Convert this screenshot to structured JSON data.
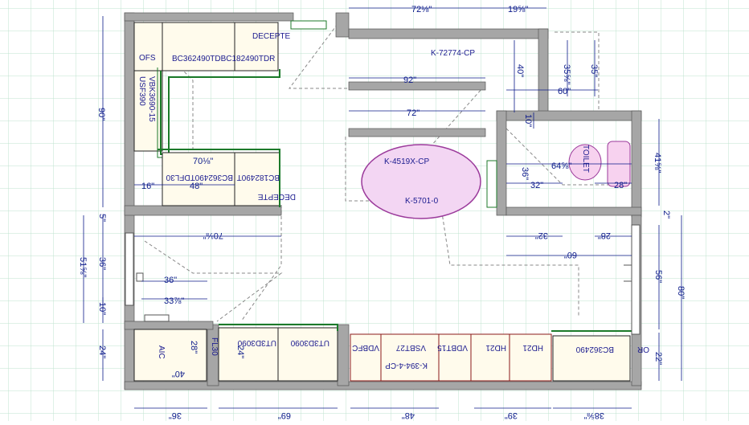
{
  "plan": {
    "colors": {
      "grid": "#bfe3cf",
      "wall": "#a6a6a6",
      "dimension": "#0b1a8a",
      "cabinet_fill": "#fffbec",
      "cabinet_outline": "#1c7a2a",
      "appliance_outline": "#8b1a1a",
      "toilet_fill": "#f7d2ef",
      "island_fill": "#f3d6f3",
      "island_outline": "#9b3a9b",
      "dashed": "#888888"
    },
    "cabinet_labels": {
      "bc362490": "BC362490TDBC182490TDR",
      "decepte_top": "DECEPTE",
      "ofs": "OFS",
      "vbk": "VBK3690-15",
      "usf": "USF390",
      "bc_lower": "BC362490TDFL30",
      "bc18": "BC182490T",
      "decepte_low": "DECEPTE",
      "island_cp": "K-4519X-CP",
      "island_small": "K-5701-0",
      "k72774": "K-72774-CP",
      "toilet": "TOILET",
      "aic": "AIC",
      "fl30": "FL30",
      "ut_a": "UT3D3090",
      "ut_b": "UT3D3090",
      "vdbfc": "VDBFC",
      "vsbt27": "VSBT27",
      "vdbt15": "VDBT15",
      "k394": "K-394-4-CP",
      "hd21a": "HD21",
      "hd21b": "HD21",
      "bc362490_r": "BC362490",
      "or": "OR"
    },
    "dimensions": {
      "top_72": "72⅛\"",
      "top_19": "19⅝\"",
      "left_90": "90\"",
      "d_92": "92\"",
      "d_72": "72\"",
      "d_40": "40\"",
      "d_35a": "35⅝\"",
      "d_35b": "35\"",
      "d_60a": "60\"",
      "d_10": "10\"",
      "d_64": "64⅝\"",
      "d_32a": "32\"",
      "d_28a": "28\"",
      "d_36": "36\"",
      "d_41": "41⅝\"",
      "d_16": "16\"",
      "d_48": "48\"",
      "d_70a": "70⅛\"",
      "d_70b": "70⅛\"",
      "d_32b": "32\"",
      "d_28b": "28\"",
      "d_60b": "60\"",
      "d_51": "51⅝\"",
      "d_36v": "36\"",
      "d_10v": "10\"",
      "d_24": "24\"",
      "d_36h": "36\"",
      "d_33": "33⅞\"",
      "d_56": "56\"",
      "d_80": "80\"",
      "d_22": "22\"",
      "d_28c": "28\"",
      "d_24b": "24\"",
      "d_40b": "40\"",
      "b_36": "36\"",
      "b_69": "69\"",
      "b_48": "48\"",
      "b_39": "39\"",
      "b_38": "38⅝\"",
      "d_5": "5\"",
      "d_2": "2\""
    }
  }
}
